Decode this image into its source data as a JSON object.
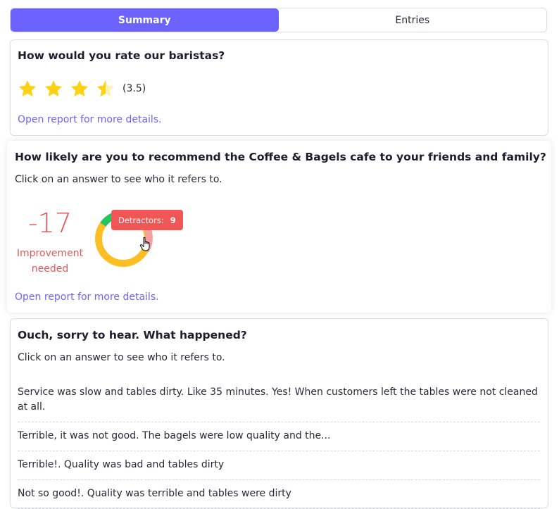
{
  "tabs": {
    "summary": "Summary",
    "entries": "Entries"
  },
  "rating_card": {
    "question": "How would you rate our baristas?",
    "rating": 3.5,
    "max": 5,
    "rating_text": "(3.5)",
    "link": "Open report for more details."
  },
  "nps_card": {
    "question": "How likely are you to recommend the Coffee & Bagels cafe to your friends and family?",
    "hint": "Click on an answer to see who it refers to.",
    "score": "-17",
    "label_line1": "Improvement",
    "label_line2": "needed",
    "tooltip_label": "Detractors:",
    "tooltip_value": "9",
    "link": "Open report for more details.",
    "colors": {
      "detractors": "#f0696b",
      "passives": "#fbbf24",
      "promoters": "#22c55e"
    }
  },
  "happened_card": {
    "question": "Ouch, sorry to hear. What happened?",
    "hint": "Click on an answer to see who it refers to.",
    "answers": [
      "Service was slow and tables dirty. Like 35 minutes. Yes! When customers left the tables were not cleaned at all.",
      "Terrible, it was not good. The bagels were low quality and the...",
      "Terrible!. Quality was bad and tables dirty",
      "Not so good!. Quality was terrible and tables were dirty"
    ]
  },
  "colors": {
    "accent": "#6c63ff",
    "negative": "#e05a5a",
    "star": "#fcd116"
  }
}
